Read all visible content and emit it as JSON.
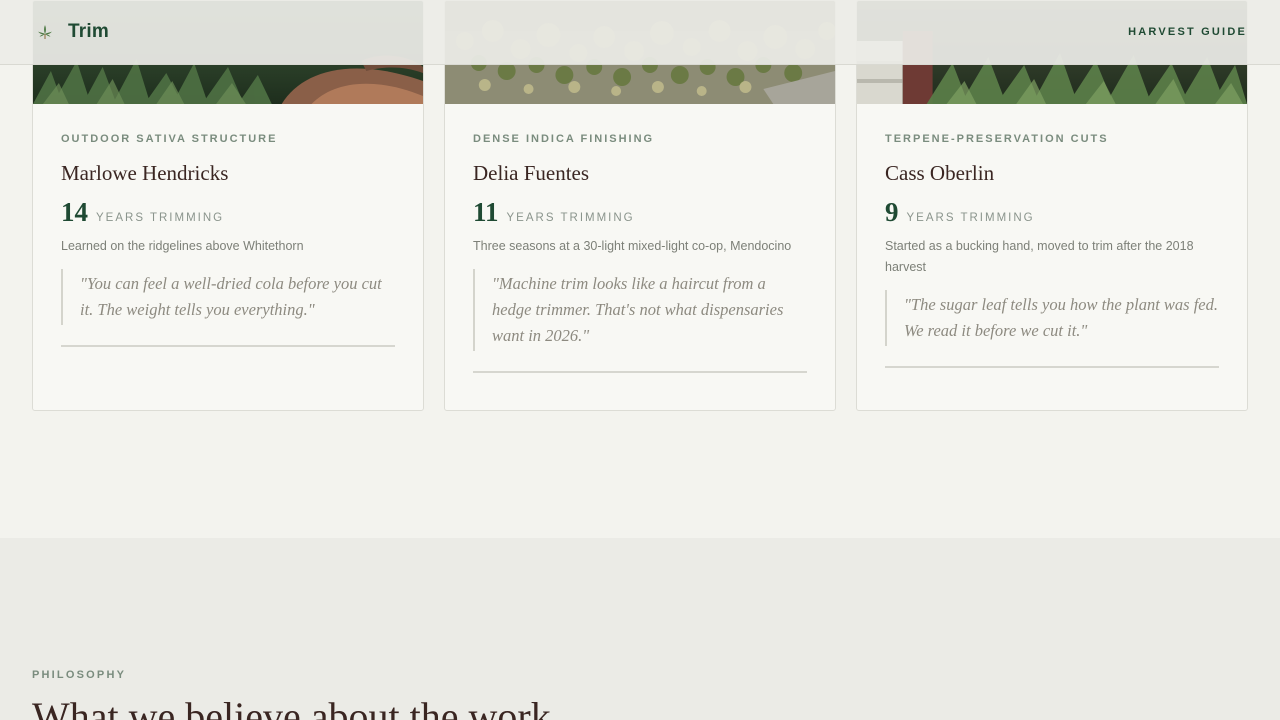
{
  "header": {
    "brand": "Trim",
    "brand_icon": "cannabis-leaf-icon",
    "nav_link": "HARVEST GUIDE"
  },
  "colors": {
    "brand_green": "#1f4a33",
    "page_bg": "#f3f3ee",
    "card_bg": "#f8f8f4",
    "section_bg": "#ebebe6",
    "heading_brown": "#3a2622",
    "eyebrow_sage": "#7a8c7e"
  },
  "trimmers": [
    {
      "specialty": "OUTDOOR SATIVA STRUCTURE",
      "name": "Marlowe Hendricks",
      "years": "14",
      "years_label": "YEARS TRIMMING",
      "origin": "Learned on the ridgelines above Whitethorn",
      "quote": "\"You can feel a well-dried cola before you cut it. The weight tells you everything.\""
    },
    {
      "specialty": "DENSE INDICA FINISHING",
      "name": "Delia Fuentes",
      "years": "11",
      "years_label": "YEARS TRIMMING",
      "origin": "Three seasons at a 30-light mixed-light co-op, Mendocino",
      "quote": "\"Machine trim looks like a haircut from a hedge trimmer. That's not what dispensaries want in 2026.\""
    },
    {
      "specialty": "TERPENE-PRESERVATION CUTS",
      "name": "Cass Oberlin",
      "years": "9",
      "years_label": "YEARS TRIMMING",
      "origin": "Started as a bucking hand, moved to trim after the 2018 harvest",
      "quote": "\"The sugar leaf tells you how the plant was fed. We read it before we cut it.\""
    }
  ],
  "philosophy": {
    "eyebrow": "PHILOSOPHY",
    "title": "What we believe about the work"
  }
}
